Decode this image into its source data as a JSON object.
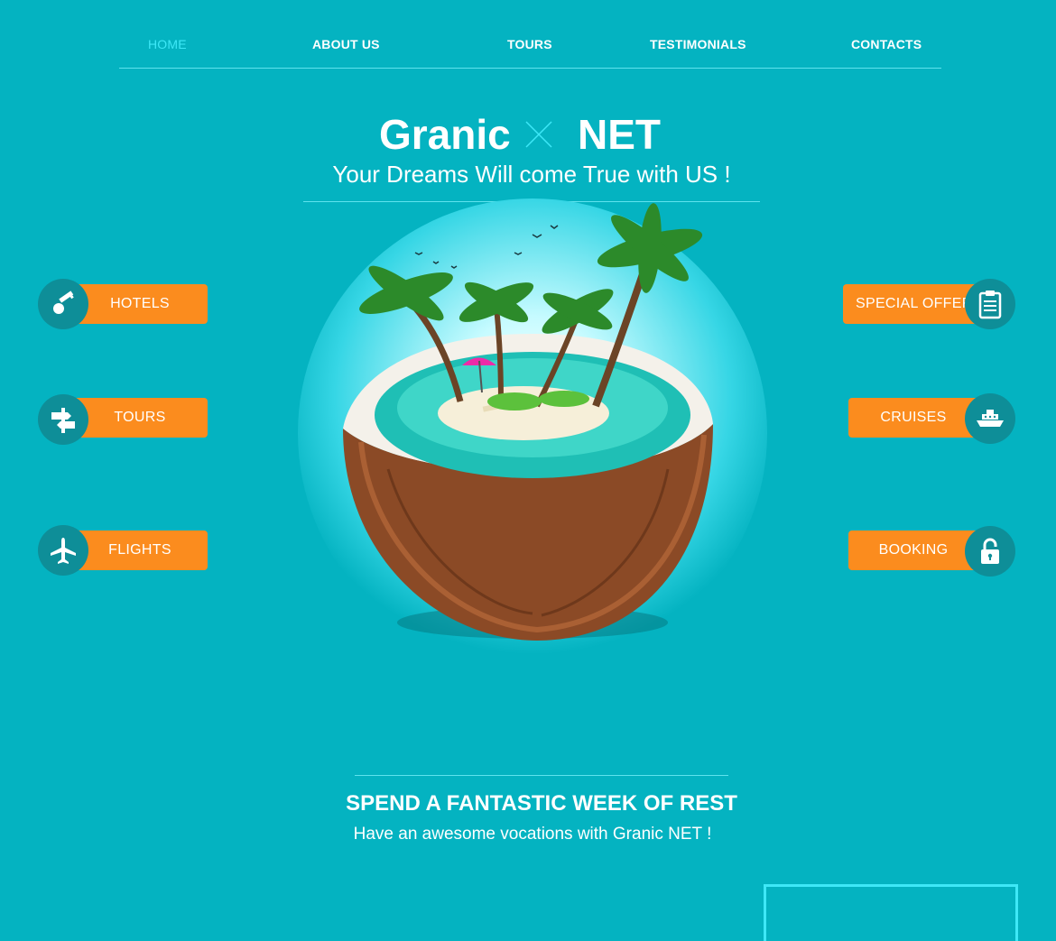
{
  "nav": {
    "items": [
      {
        "label": "HOME",
        "active": true
      },
      {
        "label": "ABOUT US",
        "active": false
      },
      {
        "label": "TOURS",
        "active": false
      },
      {
        "label": "TESTIMONIALS",
        "active": false
      },
      {
        "label": "CONTACTS",
        "active": false
      }
    ]
  },
  "hero": {
    "brand_left": "Granic",
    "brand_right": "NET",
    "tagline": "Your Dreams Will come True with US !"
  },
  "left_buttons": [
    {
      "label": "HOTELS",
      "icon": "key-icon"
    },
    {
      "label": "TOURS",
      "icon": "signpost-icon"
    },
    {
      "label": "FLIGHTS",
      "icon": "airplane-icon"
    }
  ],
  "right_buttons": [
    {
      "label": "SPECIAL OFFER",
      "icon": "clipboard-icon"
    },
    {
      "label": "CRUISES",
      "icon": "ship-icon"
    },
    {
      "label": "BOOKING",
      "icon": "padlock-icon"
    }
  ],
  "bottom": {
    "title": "SPEND A FANTASTIC WEEK OF REST",
    "subtitle": "Have an awesome vocations with Granic NET !"
  },
  "colors": {
    "background": "#04b3c1",
    "accent_orange": "#fb8c1e",
    "icon_circle": "#0e8e98",
    "active_nav": "#3ee8f7"
  }
}
